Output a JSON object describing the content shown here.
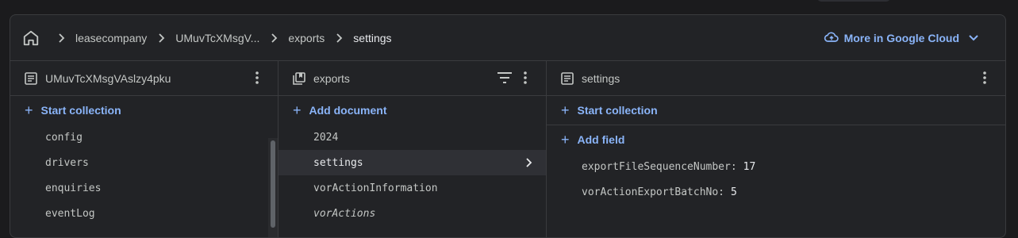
{
  "breadcrumb": {
    "items": [
      "leasecompany",
      "UMuvTcXMsgV...",
      "exports",
      "settings"
    ]
  },
  "header": {
    "cloud_button_label": "More in Google Cloud"
  },
  "columns": {
    "collection_doc": {
      "title": "UMuvTcXMsgVAslzy4pku",
      "action_label": "Start collection",
      "items": [
        "config",
        "drivers",
        "enquiries",
        "eventLog"
      ]
    },
    "exports": {
      "title": "exports",
      "action_label": "Add document",
      "items": [
        "2024",
        "settings",
        "vorActionInformation",
        "vorActions"
      ]
    },
    "settings": {
      "title": "settings",
      "start_collection_label": "Start collection",
      "add_field_label": "Add field",
      "fields": [
        {
          "key": "exportFileSequenceNumber:",
          "value": "17"
        },
        {
          "key": "vorActionExportBatchNo:",
          "value": "5"
        }
      ]
    }
  },
  "colors": {
    "accent": "#8ab4f8",
    "panel": "#222326",
    "border": "#3a3b3e"
  },
  "icons": {
    "home": "home-icon",
    "separator": "chevron-right-icon",
    "cloud": "cloud-icon",
    "document": "document-icon",
    "collection": "collection-icon",
    "menu": "more-vert-icon",
    "filter": "filter-icon"
  }
}
